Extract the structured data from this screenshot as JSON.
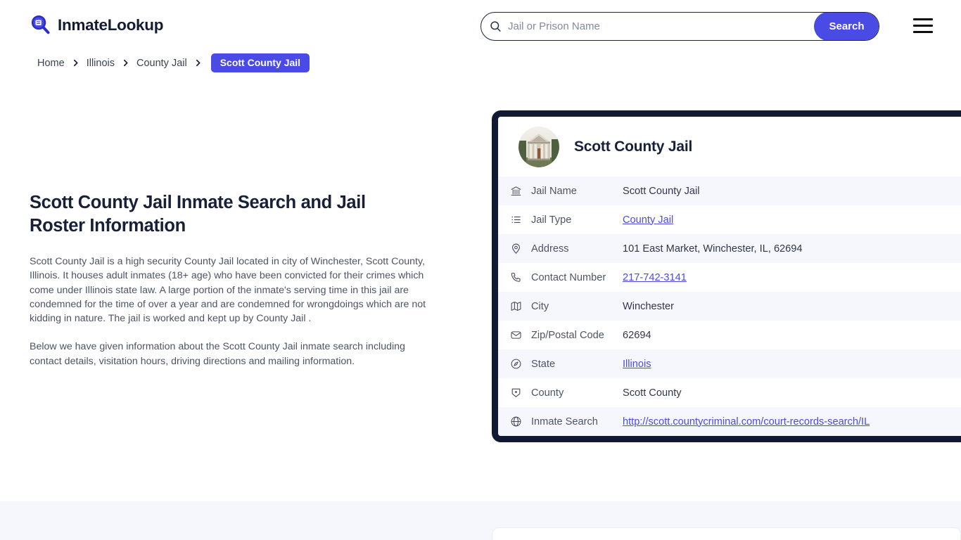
{
  "header": {
    "brand_name": "InmateLookup",
    "brand_icon": "magnifier-logo-icon",
    "menu_icon": "hamburger-menu-icon",
    "search": {
      "icon": "search-icon",
      "placeholder": "Jail or Prison Name",
      "value": "",
      "button_label": "Search"
    }
  },
  "breadcrumb": {
    "items": [
      {
        "label": "Home",
        "current": false
      },
      {
        "label": "Illinois",
        "current": false
      },
      {
        "label": "County Jail",
        "current": false
      },
      {
        "label": "Scott County Jail",
        "current": true
      }
    ],
    "separator_icon": "chevron-right-icon"
  },
  "main": {
    "title": "Scott County Jail Inmate Search and Jail Roster Information",
    "paragraph_1": "Scott County Jail is a high security County Jail located in city of Winchester, Scott County, Illinois. It houses adult inmates (18+ age) who have been convicted for their crimes which come under Illinois state law. A large portion of the inmate's serving time in this jail are condemned for the time of over a year and are condemned for wrongdoings which are not kidding in nature. The jail is worked and kept up by County Jail .",
    "paragraph_2": "Below we have given information about the Scott County Jail inmate search including contact details, visitation hours, driving directions and mailing information."
  },
  "card": {
    "title": "Scott County Jail",
    "thumbnail_icon": "courthouse-building-photo",
    "rows": [
      {
        "icon": "bank-building-icon",
        "label": "Jail Name",
        "value": "Scott County Jail",
        "link": false
      },
      {
        "icon": "list-icon",
        "label": "Jail Type",
        "value": "County Jail",
        "link": true
      },
      {
        "icon": "map-pin-icon",
        "label": "Address",
        "value": "101 East Market, Winchester, IL, 62694",
        "link": false
      },
      {
        "icon": "phone-icon",
        "label": "Contact Number",
        "value": "217-742-3141",
        "link": true
      },
      {
        "icon": "map-icon",
        "label": "City",
        "value": "Winchester",
        "link": false
      },
      {
        "icon": "envelope-icon",
        "label": "Zip/Postal Code",
        "value": "62694",
        "link": false
      },
      {
        "icon": "compass-icon",
        "label": "State",
        "value": "Illinois",
        "link": true
      },
      {
        "icon": "county-marker-icon",
        "label": "County",
        "value": "Scott County",
        "link": false
      },
      {
        "icon": "globe-icon",
        "label": "Inmate Search",
        "value": "http://scott.countycriminal.com/court-records-search/IL",
        "link": true
      }
    ]
  },
  "colors": {
    "accent": "#4a4ae4",
    "card_border": "#111a33",
    "row_alt": "#f6f6fd",
    "heading": "#182039",
    "body_text": "#4c5464",
    "link": "#4b4be0",
    "band": "#f6f6fd"
  }
}
